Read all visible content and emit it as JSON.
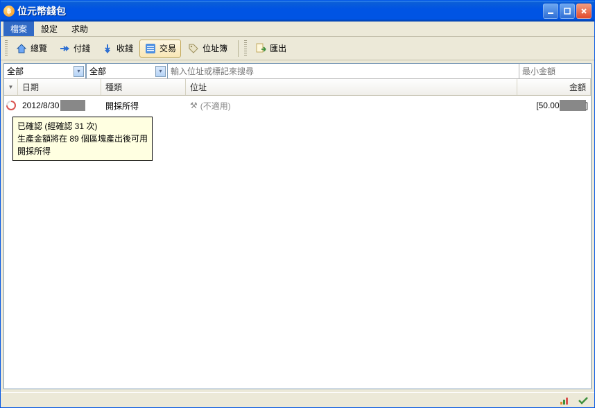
{
  "window": {
    "title": "位元幣錢包"
  },
  "menu": {
    "file": "檔案",
    "settings": "設定",
    "help": "求助"
  },
  "toolbar": {
    "overview": "總覽",
    "send": "付錢",
    "receive": "收錢",
    "transactions": "交易",
    "addressbook": "位址簿",
    "export": "匯出"
  },
  "filters": {
    "period": "全部",
    "type": "全部",
    "search_placeholder": "輸入位址或標記來搜尋",
    "min_amount_placeholder": "最小金額"
  },
  "columns": {
    "date": "日期",
    "type": "種類",
    "address": "位址",
    "amount": "金額"
  },
  "rows": [
    {
      "date": "2012/8/30",
      "type": "開採所得",
      "address": "(不適用)",
      "amount_prefix": "[50.00",
      "amount_suffix": "]"
    }
  ],
  "tooltip": {
    "line1": "已確認 (經確認 31 次)",
    "line2": "生產金額將在 89 個區塊產出後可用",
    "line3": "開採所得"
  }
}
